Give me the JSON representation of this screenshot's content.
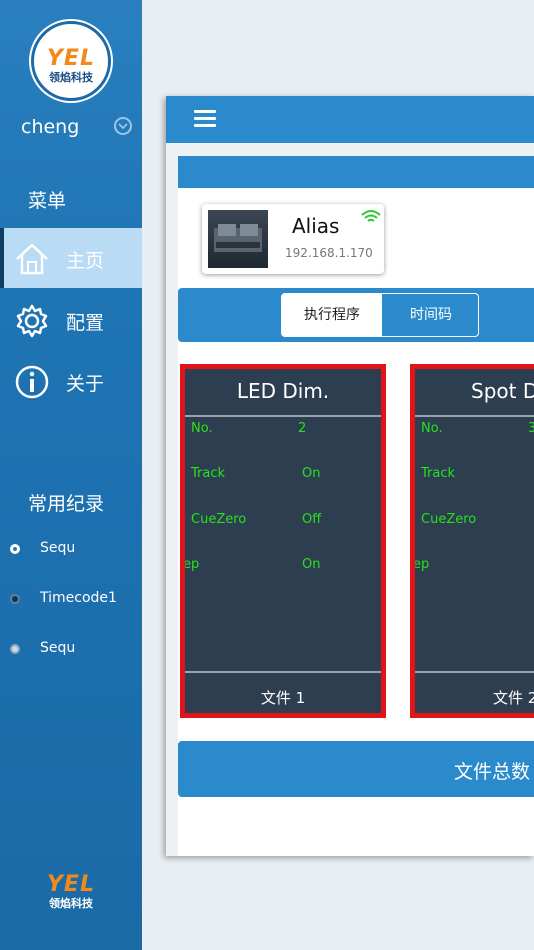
{
  "brand": {
    "logo_text": "YEL",
    "logo_sub": "领焰科技"
  },
  "user": {
    "name": "cheng"
  },
  "menu": {
    "heading": "菜单",
    "items": [
      {
        "label": "主页",
        "icon": "home-icon",
        "active": true
      },
      {
        "label": "配置",
        "icon": "gear-icon",
        "active": false
      },
      {
        "label": "关于",
        "icon": "info-icon",
        "active": false
      }
    ]
  },
  "recent": {
    "heading": "常用纪录",
    "items": [
      {
        "label": "Sequ"
      },
      {
        "label": "Timecode1"
      },
      {
        "label": "Sequ"
      }
    ]
  },
  "device": {
    "name": "Alias",
    "ip": "192.168.1.170"
  },
  "tabs": {
    "active": "执行程序",
    "other": "时间码"
  },
  "cards": [
    {
      "title": "LED Dim.",
      "no_label": "No.",
      "no_value": "2",
      "track_label": "Track",
      "track_value": "On",
      "cuezero_label": "CueZero",
      "cuezero_value": "Off",
      "ep_label": "ep",
      "ep_value": "On",
      "footer": "文件 1"
    },
    {
      "title": "Spot D",
      "no_label": "No.",
      "no_value": "3",
      "track_label": "Track",
      "track_value": "",
      "cuezero_label": "CueZero",
      "cuezero_value": "",
      "ep_label": "ep",
      "ep_value": "",
      "footer": "文件 2"
    }
  ],
  "total_button": {
    "label": "文件总数"
  },
  "colors": {
    "sidebar": "#1f74b4",
    "accent": "#2a8acb",
    "card_border": "#e0141b",
    "card_bg": "#2d3e50",
    "value_green": "#27e21c",
    "logo_orange": "#f28a1a"
  }
}
